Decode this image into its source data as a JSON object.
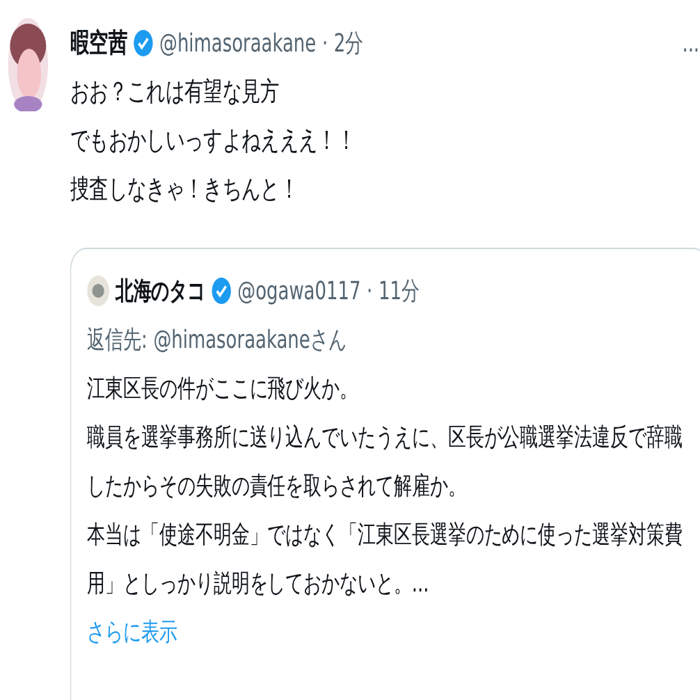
{
  "tweet": {
    "name": "暇空茜",
    "verified": true,
    "handle": "@himasoraakane",
    "separator": "·",
    "time": "2分",
    "more": "...",
    "lines": [
      "おお？これは有望な見方",
      "でもおかしいっすよねえええ！！",
      "捜査しなきゃ！きちんと！"
    ]
  },
  "quoted": {
    "name": "北海のタコ",
    "verified": true,
    "handle": "@ogawa0117",
    "separator": "·",
    "time": "11分",
    "reply_label": "返信先:",
    "reply_handle": "@himasoraakaneさん",
    "paragraphs": [
      "江東区長の件がここに飛び火か。",
      "職員を選挙事務所に送り込んでいたうえに、区長が公職選挙法違反で辞職したからその失敗の責任を取らされて解雇か。",
      "本当は「使途不明金」ではなく「江東区長選挙のために使った選挙対策費用」としっかり説明をしておかないと。..."
    ],
    "show_more": "さらに表示"
  }
}
